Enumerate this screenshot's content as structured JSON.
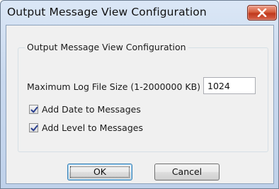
{
  "window": {
    "title": "Output Message View Configuration"
  },
  "group": {
    "legend": "Output Message View Configuration",
    "max_log_label": "Maximum Log File Size (1-2000000 KB)",
    "max_log_value": "1024",
    "options": [
      {
        "label": "Add Date to Messages",
        "checked": true
      },
      {
        "label": "Add Level to Messages",
        "checked": true
      }
    ]
  },
  "buttons": {
    "ok": "OK",
    "cancel": "Cancel"
  },
  "icons": {
    "close": "close-icon",
    "check": "checkmark-icon"
  },
  "colors": {
    "title_bar": "#c9d9ee",
    "close_button": "#c0391c",
    "client_bg": "#f0f0f0",
    "default_button_border": "#3c7fb1"
  }
}
